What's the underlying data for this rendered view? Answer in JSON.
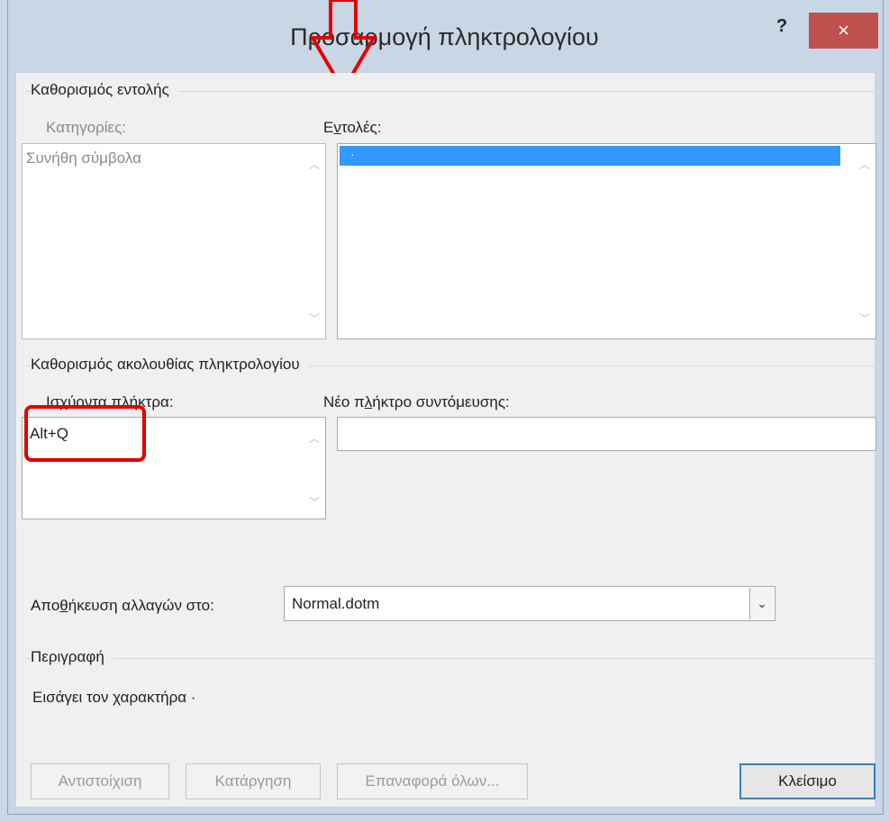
{
  "window": {
    "title": "Προσαρμογή πληκτρολογίου",
    "help_label": "?",
    "close_label": "×"
  },
  "command_group": {
    "title": "Καθορισμός εντολής",
    "categories_label": "Κατηγορίες:",
    "categories_items": [
      "Συνήθη σύμβολα"
    ],
    "commands_label_pre": "Ε",
    "commands_label_acc": "ν",
    "commands_label_post": "τολές:",
    "commands_selected": "·"
  },
  "keyboard_group": {
    "title": "Καθορισμός ακολουθίας πληκτρολογίου",
    "current_keys_label": "Ισχύοντα πλήκτρα:",
    "current_keys_items": [
      "Alt+Q"
    ],
    "new_key_label_pre": "Νέο π",
    "new_key_label_acc": "λ",
    "new_key_label_post": "ήκτρο συντόμευσης:",
    "new_key_value": ""
  },
  "save_changes": {
    "label_pre": "Απο",
    "label_acc": "θ",
    "label_post": "ήκευση αλλαγών στο:",
    "value": "Normal.dotm"
  },
  "description": {
    "title": "Περιγραφή",
    "text": "Εισάγει τον χαρακτήρα ·"
  },
  "buttons": {
    "assign": "Αντιστοίχιση",
    "remove": "Κατάργηση",
    "reset_all": "Επαναφορά όλων...",
    "close": "Κλείσιμο"
  },
  "annotations": {
    "color": "#e50000"
  },
  "colors": {
    "selection": "#3399ff",
    "close_button": "#c0504d",
    "default_button_border": "#3c7fb1"
  }
}
